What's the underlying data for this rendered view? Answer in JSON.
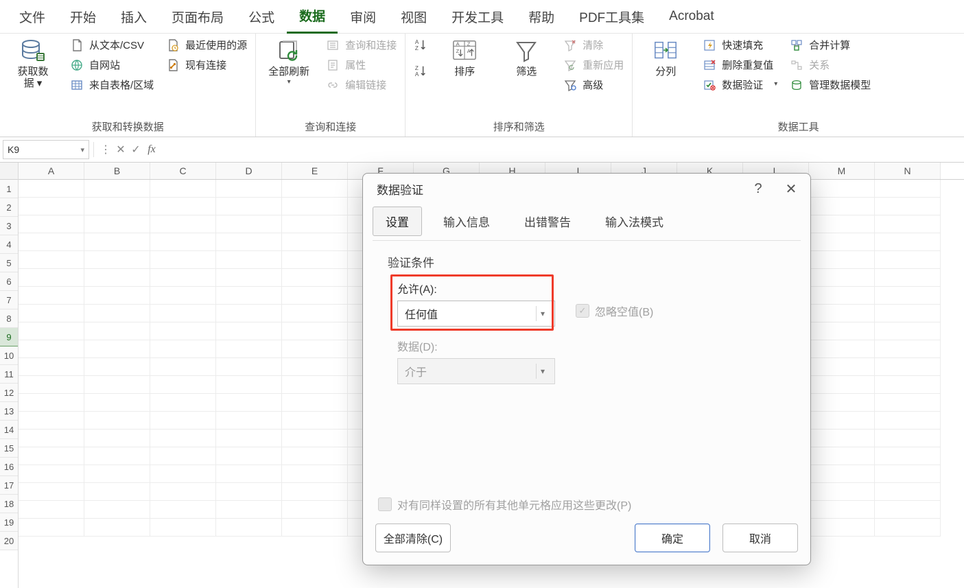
{
  "tabs": {
    "items": [
      "文件",
      "开始",
      "插入",
      "页面布局",
      "公式",
      "数据",
      "审阅",
      "视图",
      "开发工具",
      "帮助",
      "PDF工具集",
      "Acrobat"
    ],
    "activeIndex": 5
  },
  "ribbon": {
    "group1": {
      "label": "获取和转换数据",
      "getData": "获取数\n据 ▾",
      "csv": "从文本/CSV",
      "web": "自网站",
      "table": "来自表格/区域",
      "recent": "最近使用的源",
      "existing": "现有连接"
    },
    "group2": {
      "label": "查询和连接",
      "refresh": "全部刷新",
      "queries": "查询和连接",
      "props": "属性",
      "links": "编辑链接"
    },
    "group3": {
      "label": "排序和筛选",
      "sort": "排序",
      "filter": "筛选",
      "clear": "清除",
      "reapply": "重新应用",
      "advanced": "高级"
    },
    "group4": {
      "label": "数据工具",
      "textcol": "分列",
      "flash": "快速填充",
      "dedup": "删除重复值",
      "valid": "数据验证",
      "consolidate": "合并计算",
      "relations": "关系",
      "model": "管理数据模型"
    }
  },
  "formulaBar": {
    "nameBox": "K9",
    "fx": "fx"
  },
  "grid": {
    "cols": [
      "A",
      "B",
      "C",
      "D",
      "E",
      "F",
      "G",
      "H",
      "I",
      "J",
      "K",
      "L",
      "M",
      "N"
    ],
    "rows": 20,
    "selectedRow": 9
  },
  "dialog": {
    "title": "数据验证",
    "help": "?",
    "close": "✕",
    "tabs": [
      "设置",
      "输入信息",
      "出错警告",
      "输入法模式"
    ],
    "activeTab": 0,
    "sectionTitle": "验证条件",
    "allow": {
      "label": "允许(A):",
      "value": "任何值"
    },
    "ignoreBlank": "忽略空值(B)",
    "data": {
      "label": "数据(D):",
      "value": "介于"
    },
    "applyAll": "对有同样设置的所有其他单元格应用这些更改(P)",
    "clearAll": "全部清除(C)",
    "ok": "确定",
    "cancel": "取消"
  }
}
